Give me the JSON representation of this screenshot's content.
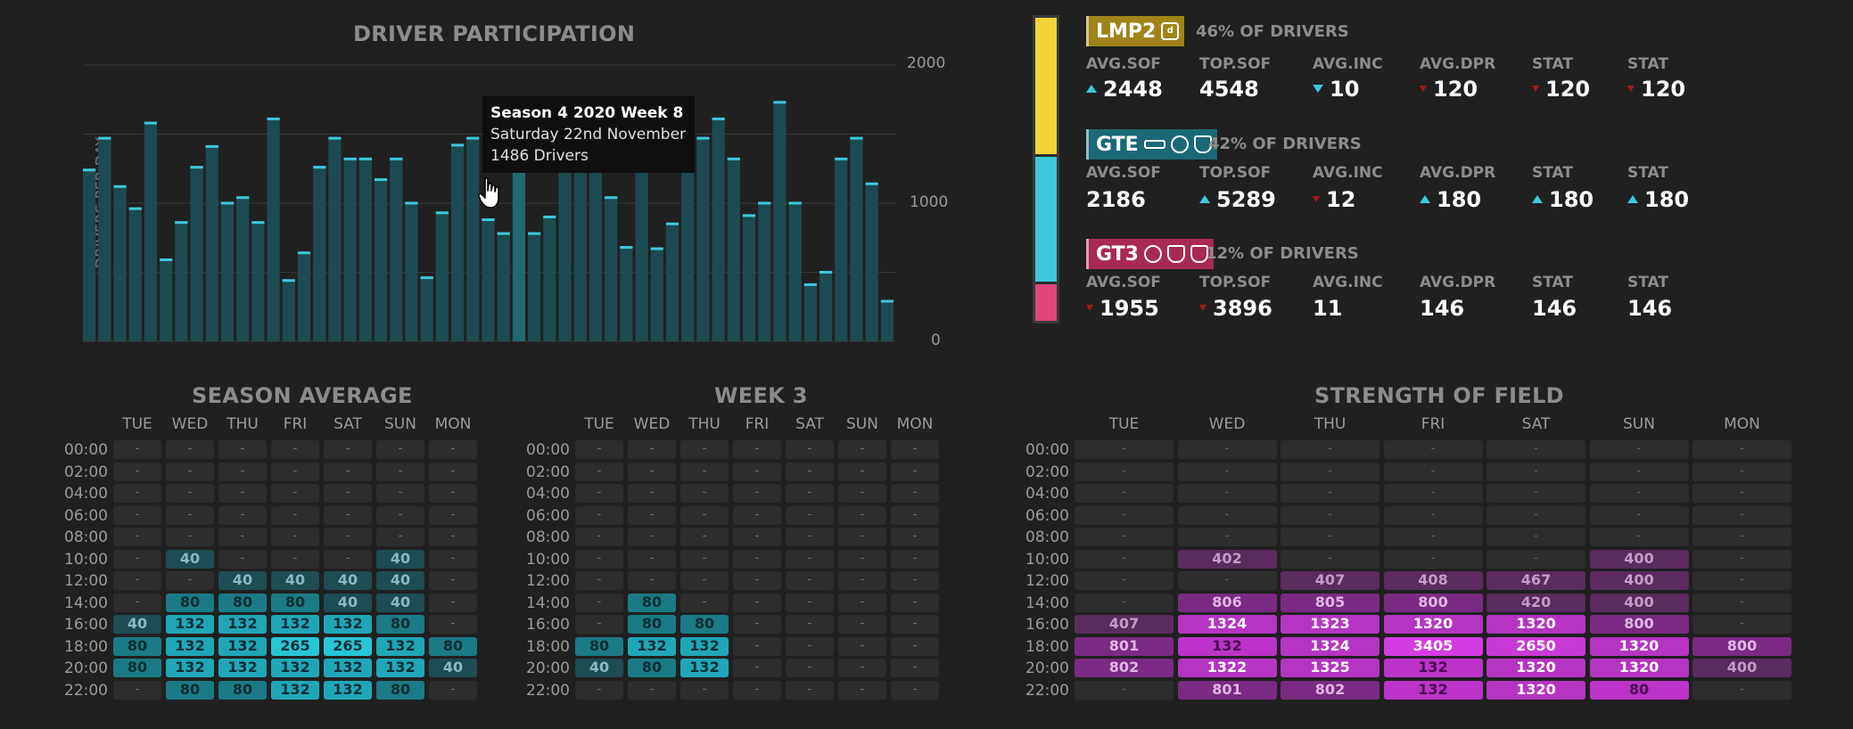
{
  "participation": {
    "title": "DRIVER PARTICIPATION",
    "ylabel": "DRIVERS PER DAY",
    "yticks": [
      "2000",
      "1000",
      "0"
    ],
    "tooltip": {
      "line1": "Season 4 2020 Week 8",
      "line2": "Saturday 22nd November",
      "line3": "1486 Drivers"
    }
  },
  "chart_data": {
    "type": "bar",
    "title": "DRIVER PARTICIPATION",
    "ylabel": "DRIVERS PER DAY",
    "ylim": [
      0,
      2000
    ],
    "grid": true,
    "highlight_index": 28,
    "values": [
      1250,
      1480,
      1130,
      970,
      1590,
      600,
      870,
      1270,
      1420,
      1010,
      1050,
      870,
      1620,
      450,
      650,
      1270,
      1480,
      1330,
      1330,
      1180,
      1330,
      1010,
      470,
      940,
      1430,
      1480,
      890,
      790,
      1330,
      790,
      910,
      1270,
      1430,
      1270,
      1050,
      690,
      1430,
      680,
      860,
      1270,
      1480,
      1620,
      1330,
      920,
      1010,
      1740,
      1010,
      420,
      510,
      1330,
      1480,
      1150,
      300
    ]
  },
  "classes": {
    "bar_colors": [
      "#f2d437",
      "#3ec8dc",
      "#e0467c"
    ],
    "bar_fractions": [
      0.46,
      0.42,
      0.12
    ],
    "items": [
      {
        "name": "LMP2",
        "color": "#a08419",
        "logo_icons": [
          "bmw-logo-icon"
        ],
        "pct": "46% OF DRIVERS",
        "stats": [
          {
            "label": "AVG.SOF",
            "value": "2448",
            "trend": "up"
          },
          {
            "label": "TOP.SOF",
            "value": "4548",
            "trend": "none"
          },
          {
            "label": "AVG.INC",
            "value": "10",
            "trend": "down"
          },
          {
            "label": "AVG.DPR",
            "value": "120",
            "trend": "neg"
          },
          {
            "label": "STAT",
            "value": "120",
            "trend": "neg"
          },
          {
            "label": "STAT",
            "value": "120",
            "trend": "neg"
          }
        ]
      },
      {
        "name": "GTE",
        "color": "#1a6878",
        "logo_icons": [
          "chevrolet-logo-icon",
          "bmw-logo-icon",
          "porsche-logo-icon"
        ],
        "pct": "42% OF DRIVERS",
        "stats": [
          {
            "label": "AVG.SOF",
            "value": "2186",
            "trend": "none"
          },
          {
            "label": "TOP.SOF",
            "value": "5289",
            "trend": "up"
          },
          {
            "label": "AVG.INC",
            "value": "12",
            "trend": "neg"
          },
          {
            "label": "AVG.DPR",
            "value": "180",
            "trend": "up"
          },
          {
            "label": "STAT",
            "value": "180",
            "trend": "up"
          },
          {
            "label": "STAT",
            "value": "180",
            "trend": "up"
          }
        ]
      },
      {
        "name": "GT3",
        "color": "#a82955",
        "logo_icons": [
          "bmw-logo-icon",
          "ferrari-logo-icon",
          "porsche-logo-icon"
        ],
        "pct": "12% OF DRIVERS",
        "stats": [
          {
            "label": "AVG.SOF",
            "value": "1955",
            "trend": "neg"
          },
          {
            "label": "TOP.SOF",
            "value": "3896",
            "trend": "neg"
          },
          {
            "label": "AVG.INC",
            "value": "11",
            "trend": "none"
          },
          {
            "label": "AVG.DPR",
            "value": "146",
            "trend": "none"
          },
          {
            "label": "STAT",
            "value": "146",
            "trend": "none"
          },
          {
            "label": "STAT",
            "value": "146",
            "trend": "none"
          }
        ]
      }
    ]
  },
  "days": [
    "TUE",
    "WED",
    "THU",
    "FRI",
    "SAT",
    "SUN",
    "MON"
  ],
  "times": [
    "00:00",
    "02:00",
    "04:00",
    "06:00",
    "08:00",
    "10:00",
    "12:00",
    "14:00",
    "16:00",
    "18:00",
    "20:00",
    "22:00"
  ],
  "season_average": {
    "title": "SEASON AVERAGE",
    "rows": [
      [
        "-",
        "-",
        "-",
        "-",
        "-",
        "-",
        "-"
      ],
      [
        "-",
        "-",
        "-",
        "-",
        "-",
        "-",
        "-"
      ],
      [
        "-",
        "-",
        "-",
        "-",
        "-",
        "-",
        "-"
      ],
      [
        "-",
        "-",
        "-",
        "-",
        "-",
        "-",
        "-"
      ],
      [
        "-",
        "-",
        "-",
        "-",
        "-",
        "-",
        "-"
      ],
      [
        "-",
        "40",
        "-",
        "-",
        "-",
        "40",
        "-"
      ],
      [
        "-",
        "-",
        "40",
        "40",
        "40",
        "40",
        "-"
      ],
      [
        "-",
        "80",
        "80",
        "80",
        "40",
        "40",
        "-"
      ],
      [
        "40",
        "132",
        "132",
        "132",
        "132",
        "80",
        "-"
      ],
      [
        "80",
        "132",
        "132",
        "265",
        "265",
        "132",
        "80"
      ],
      [
        "80",
        "132",
        "132",
        "132",
        "132",
        "132",
        "40"
      ],
      [
        "-",
        "80",
        "80",
        "132",
        "132",
        "80",
        "-"
      ]
    ]
  },
  "week3": {
    "title": "WEEK 3",
    "rows": [
      [
        "-",
        "-",
        "-",
        "-",
        "-",
        "-",
        "-"
      ],
      [
        "-",
        "-",
        "-",
        "-",
        "-",
        "-",
        "-"
      ],
      [
        "-",
        "-",
        "-",
        "-",
        "-",
        "-",
        "-"
      ],
      [
        "-",
        "-",
        "-",
        "-",
        "-",
        "-",
        "-"
      ],
      [
        "-",
        "-",
        "-",
        "-",
        "-",
        "-",
        "-"
      ],
      [
        "-",
        "-",
        "-",
        "-",
        "-",
        "-",
        "-"
      ],
      [
        "-",
        "-",
        "-",
        "-",
        "-",
        "-",
        "-"
      ],
      [
        "-",
        "80",
        "-",
        "-",
        "-",
        "-",
        "-"
      ],
      [
        "-",
        "80",
        "80",
        "-",
        "-",
        "-",
        "-"
      ],
      [
        "80",
        "132",
        "132",
        "-",
        "-",
        "-",
        "-"
      ],
      [
        "40",
        "80",
        "132",
        "-",
        "-",
        "-",
        "-"
      ],
      [
        "-",
        "-",
        "-",
        "-",
        "-",
        "-",
        "-"
      ]
    ]
  },
  "strength_of_field": {
    "title": "STRENGTH OF FIELD",
    "rows": [
      [
        "-",
        "-",
        "-",
        "-",
        "-",
        "-",
        "-"
      ],
      [
        "-",
        "-",
        "-",
        "-",
        "-",
        "-",
        "-"
      ],
      [
        "-",
        "-",
        "-",
        "-",
        "-",
        "-",
        "-"
      ],
      [
        "-",
        "-",
        "-",
        "-",
        "-",
        "-",
        "-"
      ],
      [
        "-",
        "-",
        "-",
        "-",
        "-",
        "-",
        "-"
      ],
      [
        "-",
        "402",
        "-",
        "-",
        "-",
        "400",
        "-"
      ],
      [
        "-",
        "-",
        "407",
        "408",
        "467",
        "400",
        "-"
      ],
      [
        "-",
        "806",
        "805",
        "800",
        "420",
        "400",
        "-"
      ],
      [
        "407",
        "1324",
        "1323",
        "1320",
        "1320",
        "800",
        "-"
      ],
      [
        "801",
        "132",
        "1324",
        "3405",
        "2650",
        "1320",
        "800"
      ],
      [
        "802",
        "1322",
        "1325",
        "132",
        "1320",
        "1320",
        "400"
      ],
      [
        "-",
        "801",
        "802",
        "132",
        "1320",
        "80",
        "-"
      ]
    ]
  }
}
